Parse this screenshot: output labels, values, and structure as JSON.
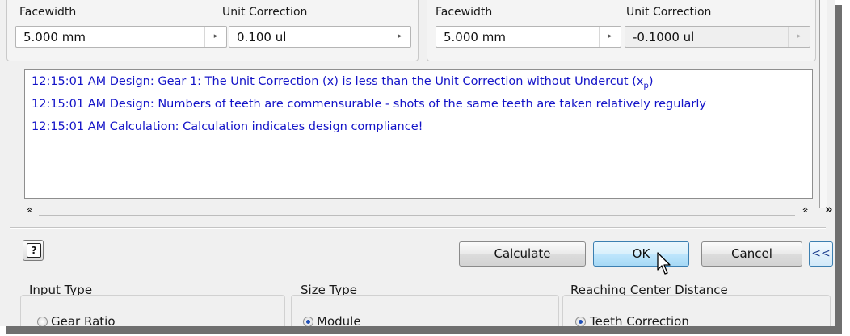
{
  "left_gear": {
    "facewidth_label": "Facewidth",
    "unit_correction_label": "Unit Correction",
    "facewidth_value": "5.000 mm",
    "unit_correction_value": "0.100 ul"
  },
  "right_gear": {
    "facewidth_label": "Facewidth",
    "unit_correction_label": "Unit Correction",
    "facewidth_value": "5.000 mm",
    "unit_correction_value": "-0.1000 ul"
  },
  "messages": {
    "line1_main": "12:15:01 AM Design: Gear 1: The Unit Correction (x) is less than the Unit Correction without Undercut (x",
    "line1_sub": "p",
    "line1_end": ")",
    "line2": "12:15:01 AM Design: Numbers of teeth are commensurable - shots of the same teeth are taken relatively regularly",
    "line3": "12:15:01 AM Calculation: Calculation indicates design compliance!"
  },
  "buttons": {
    "help": "?",
    "calculate": "Calculate",
    "ok": "OK",
    "cancel": "Cancel",
    "collapse": "<<",
    "expand": "»"
  },
  "sections": {
    "input_type": {
      "title": "Input Type",
      "option": "Gear Ratio",
      "selected": false
    },
    "size_type": {
      "title": "Size Type",
      "option": "Module",
      "selected": true
    },
    "reaching_center": {
      "title": "Reaching Center Distance",
      "option": "Teeth Correction",
      "selected": true
    }
  },
  "icons": {
    "spin_arrow": "▸",
    "splitter_chevron": "«"
  }
}
